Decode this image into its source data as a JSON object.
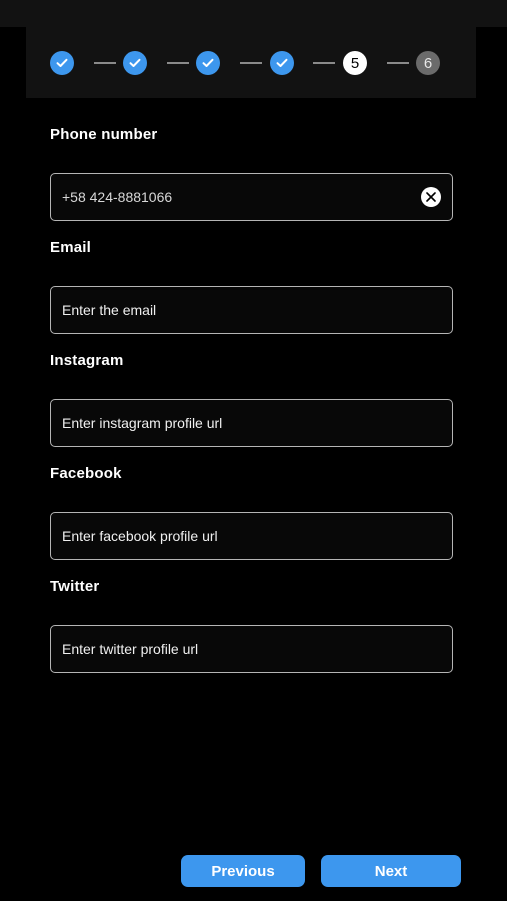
{
  "colors": {
    "accent": "#3d97ee",
    "current_step": "#ffffff",
    "pending_step": "#6b6b6b"
  },
  "stepper": {
    "steps": [
      {
        "label": "1",
        "state": "done",
        "icon": "check-icon"
      },
      {
        "label": "2",
        "state": "done",
        "icon": "check-icon"
      },
      {
        "label": "3",
        "state": "done",
        "icon": "check-icon"
      },
      {
        "label": "4",
        "state": "done",
        "icon": "check-icon"
      },
      {
        "label": "5",
        "state": "current"
      },
      {
        "label": "6",
        "state": "todo"
      }
    ]
  },
  "form": {
    "phone": {
      "label": "Phone number",
      "value": "+58 424-8881066",
      "clear_icon": "close-circle-icon"
    },
    "email": {
      "label": "Email",
      "placeholder": "Enter the email"
    },
    "instagram": {
      "label": "Instagram",
      "placeholder": "Enter instagram profile url"
    },
    "facebook": {
      "label": "Facebook",
      "placeholder": "Enter facebook profile url"
    },
    "twitter": {
      "label": "Twitter",
      "placeholder": "Enter twitter profile url"
    }
  },
  "buttons": {
    "previous": "Previous",
    "next": "Next"
  }
}
